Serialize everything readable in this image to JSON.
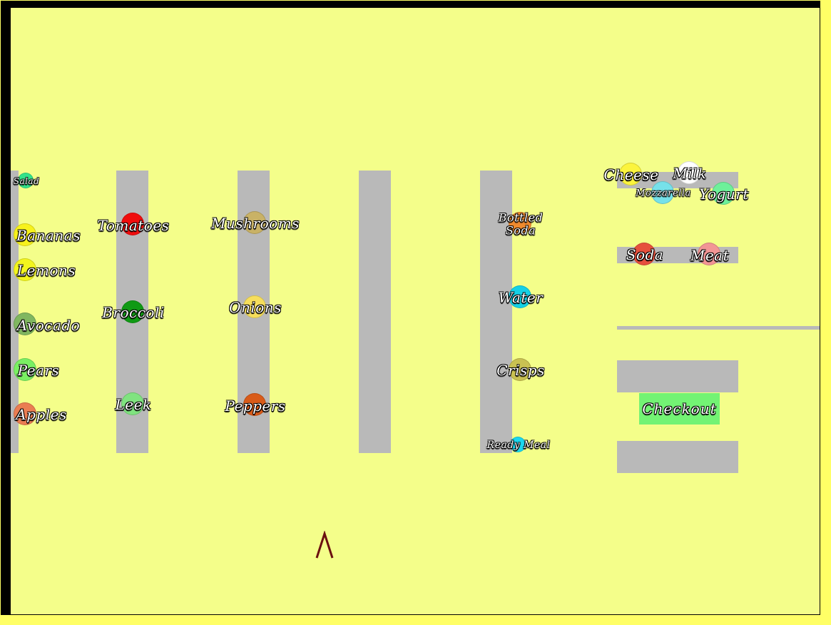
{
  "store": {
    "checkout_label": "Checkout",
    "player": {
      "icon": "caret-up-icon",
      "color": "#6b1010"
    }
  },
  "products": [
    {
      "label": "Salad",
      "color": "#33e38a"
    },
    {
      "label": "Bananas",
      "color": "#f7f21c"
    },
    {
      "label": "Lemons",
      "color": "#f3f51e"
    },
    {
      "label": "Avocado",
      "color": "#80b760"
    },
    {
      "label": "Pears",
      "color": "#7af063"
    },
    {
      "label": "Apples",
      "color": "#ea7d52"
    },
    {
      "label": "Tomatoes",
      "color": "#f00d0d"
    },
    {
      "label": "Broccoli",
      "color": "#109a14"
    },
    {
      "label": "Leek",
      "color": "#80e380"
    },
    {
      "label": "Mushrooms",
      "color": "#c9b266"
    },
    {
      "label": "Onions",
      "color": "#f6de5c"
    },
    {
      "label": "Peppers",
      "color": "#d95b19"
    },
    {
      "label": "Bottled",
      "color": "#ef8a2e"
    },
    {
      "label": "Soda",
      "color": "#ef8a2e"
    },
    {
      "label": "Water",
      "color": "#14d1e6"
    },
    {
      "label": "Crisps",
      "color": "#c9c152"
    },
    {
      "label": "Ready Meal",
      "color": "#1ad7ee"
    },
    {
      "label": "Cheese",
      "color": "#fbf43e"
    },
    {
      "label": "Milk",
      "color": "#ffffff"
    },
    {
      "label": "Mozzarella",
      "color": "#76e1ea"
    },
    {
      "label": "Yogurt",
      "color": "#6ef09a"
    },
    {
      "label": "Soda",
      "color": "#e6503d"
    },
    {
      "label": "Meat",
      "color": "#f29595"
    }
  ]
}
